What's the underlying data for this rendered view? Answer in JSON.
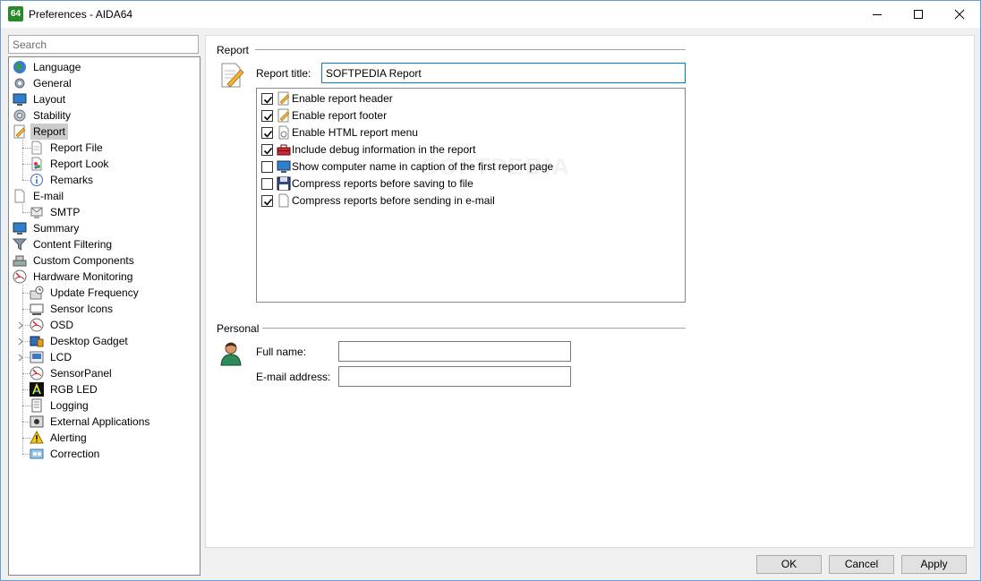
{
  "window": {
    "title": "Preferences - AIDA64",
    "app_icon_text": "64",
    "minimize_icon": "minimize-icon",
    "maximize_icon": "maximize-icon",
    "close_icon": "close-icon"
  },
  "sidebar": {
    "search_placeholder": "Search",
    "items": [
      {
        "label": "Language",
        "icon": "globe-icon"
      },
      {
        "label": "General",
        "icon": "gear-icon"
      },
      {
        "label": "Layout",
        "icon": "monitor-icon"
      },
      {
        "label": "Stability",
        "icon": "cog-icon"
      },
      {
        "label": "Report",
        "icon": "report-pencil-icon",
        "selected": true
      },
      {
        "label": "Report File",
        "icon": "document-icon"
      },
      {
        "label": "Report Look",
        "icon": "palette-icon"
      },
      {
        "label": "Remarks",
        "icon": "info-icon"
      },
      {
        "label": "E-mail",
        "icon": "document-icon"
      },
      {
        "label": "SMTP",
        "icon": "mail-server-icon"
      },
      {
        "label": "Summary",
        "icon": "monitor-icon"
      },
      {
        "label": "Content Filtering",
        "icon": "funnel-icon"
      },
      {
        "label": "Custom Components",
        "icon": "components-icon"
      },
      {
        "label": "Hardware Monitoring",
        "icon": "gauge-icon"
      },
      {
        "label": "Update Frequency",
        "icon": "clock-icon"
      },
      {
        "label": "Sensor Icons",
        "icon": "sensor-icon"
      },
      {
        "label": "OSD",
        "icon": "gauge-icon"
      },
      {
        "label": "Desktop Gadget",
        "icon": "gadget-icon"
      },
      {
        "label": "LCD",
        "icon": "lcd-icon"
      },
      {
        "label": "SensorPanel",
        "icon": "gauge-icon"
      },
      {
        "label": "RGB LED",
        "icon": "rgb-led-icon"
      },
      {
        "label": "Logging",
        "icon": "log-icon"
      },
      {
        "label": "External Applications",
        "icon": "external-app-icon"
      },
      {
        "label": "Alerting",
        "icon": "warning-icon"
      },
      {
        "label": "Correction",
        "icon": "correction-icon"
      }
    ]
  },
  "report": {
    "group_label": "Report",
    "title_label": "Report title:",
    "title_value": "SOFTPEDIA Report",
    "options": [
      {
        "label": "Enable report header",
        "checked": true,
        "icon": "report-pencil-icon"
      },
      {
        "label": "Enable report footer",
        "checked": true,
        "icon": "report-pencil-icon"
      },
      {
        "label": "Enable HTML report menu",
        "checked": true,
        "icon": "html-doc-icon"
      },
      {
        "label": "Include debug information in the report",
        "checked": true,
        "icon": "toolbox-icon"
      },
      {
        "label": "Show computer name in caption of the first report page",
        "checked": false,
        "icon": "monitor-icon"
      },
      {
        "label": "Compress reports before saving to file",
        "checked": false,
        "icon": "floppy-icon"
      },
      {
        "label": "Compress reports before sending in e-mail",
        "checked": true,
        "icon": "document-icon"
      }
    ],
    "watermark": "SOFTPEDIA"
  },
  "personal": {
    "group_label": "Personal",
    "fullname_label": "Full name:",
    "fullname_value": "",
    "email_label": "E-mail address:",
    "email_value": ""
  },
  "buttons": {
    "ok": "OK",
    "cancel": "Cancel",
    "apply": "Apply"
  },
  "colors": {
    "accent": "#0078d7",
    "selection": "#cccccc",
    "app_icon": "#2a8a2a"
  }
}
